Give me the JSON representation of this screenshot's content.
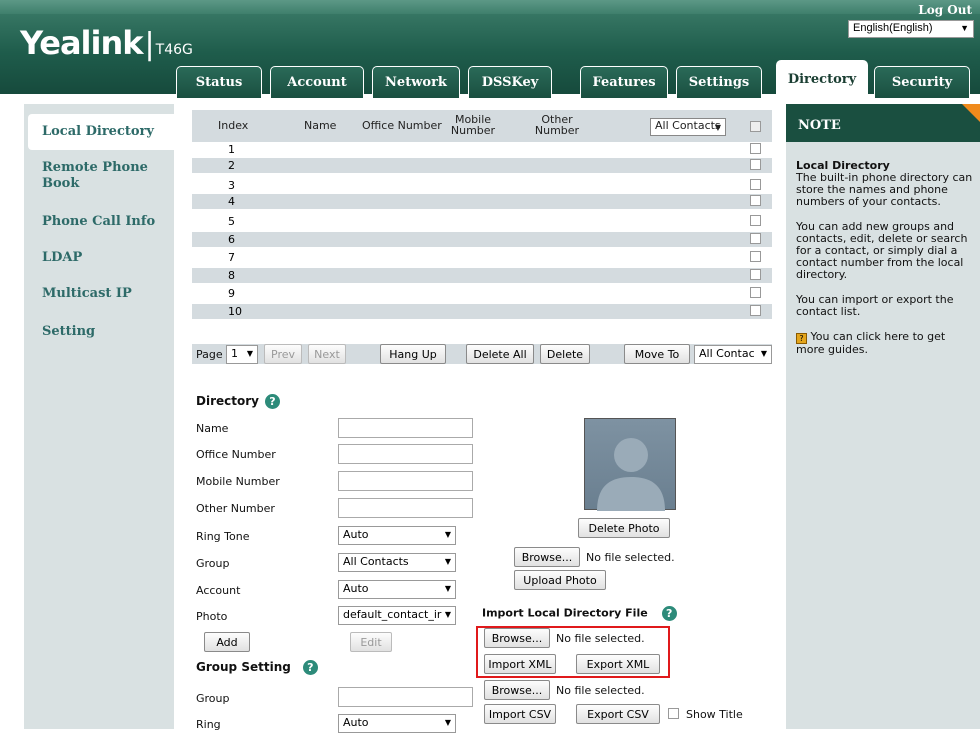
{
  "header": {
    "brand": "Yealink",
    "model": "T46G",
    "logout": "Log Out",
    "language": "English(English)"
  },
  "tabs": [
    "Status",
    "Account",
    "Network",
    "DSSKey",
    "Features",
    "Settings",
    "Directory",
    "Security"
  ],
  "active_tab": "Directory",
  "sidebar": {
    "items": [
      "Local Directory",
      "Remote Phone Book",
      "Phone Call Info",
      "LDAP",
      "Multicast IP",
      "Setting"
    ]
  },
  "table": {
    "headers": {
      "index": "Index",
      "name": "Name",
      "office": "Office Number",
      "mobile": "Mobile Number",
      "other": "Other Number"
    },
    "filter": "All Contacts",
    "rows": [
      "1",
      "2",
      "3",
      "4",
      "5",
      "6",
      "7",
      "8",
      "9",
      "10"
    ]
  },
  "pager": {
    "page_label": "Page",
    "page_value": "1",
    "prev": "Prev",
    "next": "Next",
    "hang_up": "Hang Up",
    "delete_all": "Delete All",
    "delete": "Delete",
    "move_to": "Move To",
    "move_target": "All Contac"
  },
  "directory": {
    "title": "Directory",
    "name_label": "Name",
    "office_label": "Office Number",
    "mobile_label": "Mobile Number",
    "other_label": "Other Number",
    "ring_label": "Ring Tone",
    "ring_value": "Auto",
    "group_label": "Group",
    "group_value": "All Contacts",
    "account_label": "Account",
    "account_value": "Auto",
    "photo_label": "Photo",
    "photo_value": "default_contact_ir",
    "add": "Add",
    "edit": "Edit",
    "delete_photo": "Delete Photo",
    "browse": "Browse...",
    "no_file": "No file selected.",
    "upload_photo": "Upload Photo"
  },
  "import": {
    "title": "Import Local Directory File",
    "browse": "Browse...",
    "no_file": "No file selected.",
    "import_xml": "Import XML",
    "export_xml": "Export XML",
    "browse2": "Browse...",
    "no_file2": "No file selected.",
    "import_csv": "Import CSV",
    "export_csv": "Export CSV",
    "show_title": "Show Title"
  },
  "group_setting": {
    "title": "Group Setting",
    "group_label": "Group",
    "ring_label": "Ring",
    "ring_value": "Auto"
  },
  "note": {
    "title": "NOTE",
    "heading": "Local Directory",
    "p1": "The built-in phone directory can store the names and phone numbers of your contacts.",
    "p2": "You can add new groups and contacts, edit, delete or search for a contact, or simply dial a contact number from the local directory.",
    "p3": "You can import or export the contact list.",
    "p4": "You can click here to get more guides."
  },
  "colors": {
    "header_green": "#1f5d4c",
    "nav_bg": "#d9e1e2",
    "link_teal": "#2d6a68",
    "highlight_red": "#e0191b",
    "note_corner": "#f08a1c"
  }
}
